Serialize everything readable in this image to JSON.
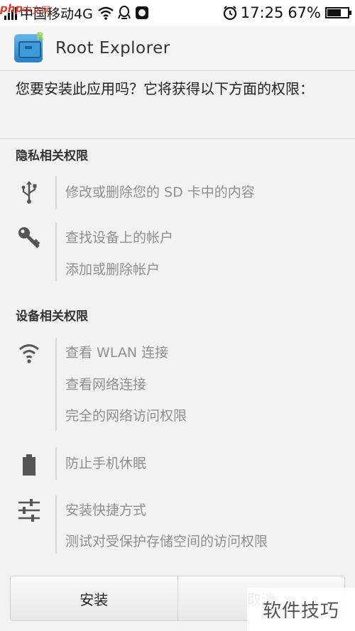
{
  "status_bar": {
    "watermark_php": "php",
    "watermark_cn": "中文网",
    "carrier": "中国移动4G",
    "time": "17:25",
    "battery_percent": "67%",
    "battery_level": 0.67
  },
  "header": {
    "app_title": "Root Explorer",
    "app_icon": "folder-icon"
  },
  "question": "您要安装此应用吗？它将获得以下方面的权限：",
  "sections": {
    "privacy": {
      "title": "隐私相关权限",
      "groups": [
        {
          "icon": "usb-icon",
          "items": [
            "修改或删除您的 SD 卡中的内容"
          ]
        },
        {
          "icon": "key-icon",
          "items": [
            "查找设备上的帐户",
            "添加或删除帐户"
          ]
        }
      ]
    },
    "device": {
      "title": "设备相关权限",
      "groups": [
        {
          "icon": "wifi-icon",
          "items": [
            "查看 WLAN 连接",
            "查看网络连接",
            "完全的网络访问权限"
          ]
        },
        {
          "icon": "battery-icon",
          "items": [
            "防止手机休眠"
          ]
        },
        {
          "icon": "sliders-icon",
          "items": [
            "安装快捷方式",
            "测试对受保护存储空间的访问权限"
          ]
        }
      ]
    }
  },
  "buttons": {
    "install": "安装",
    "cancel": "取消"
  },
  "watermark": "软件技巧",
  "colors": {
    "background": "#f2f2f2",
    "item_text": "#8f8f8f",
    "icon": "#555555"
  }
}
